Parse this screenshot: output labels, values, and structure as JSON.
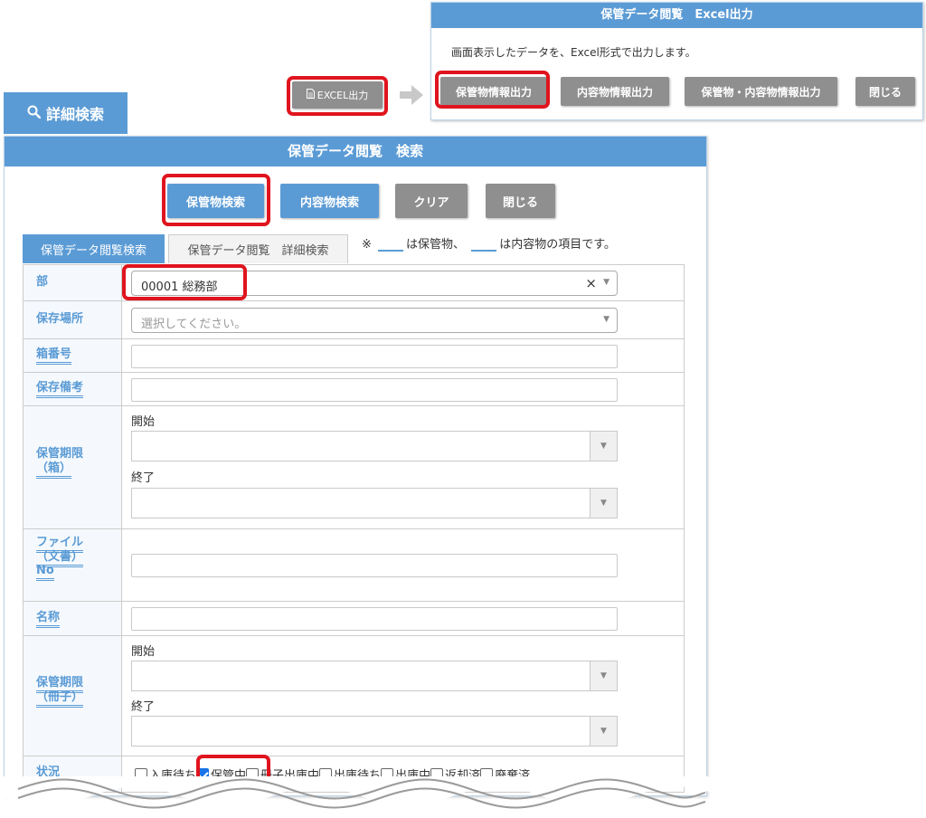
{
  "excel_dialog": {
    "title": "保管データ閲覧　Excel出力",
    "message": "画面表示したデータを、Excel形式で出力します。",
    "buttons": {
      "storage_info": "保管物情報出力",
      "content_info": "内容物情報出力",
      "both_info": "保管物・内容物情報出力",
      "close": "閉じる"
    }
  },
  "excel_button": {
    "label": "EXCEL出力",
    "icon": "document-icon"
  },
  "detail_search_tab": {
    "label": "詳細検索",
    "icon": "search-icon"
  },
  "search_panel": {
    "title": "保管データ閲覧　検索",
    "buttons": {
      "storage_search": "保管物検索",
      "content_search": "内容物検索",
      "clear": "クリア",
      "close": "閉じる"
    },
    "tabs": {
      "basic": "保管データ閲覧検索",
      "detail": "保管データ閲覧　詳細検索"
    },
    "note": {
      "prefix": "※",
      "storage_suffix": "は保管物、",
      "content_suffix": "は内容物の項目です。"
    },
    "fields": {
      "department": {
        "label": "部",
        "value": "00001 総務部",
        "clear_symbol": "×"
      },
      "location": {
        "label": "保存場所",
        "placeholder": "選択してください。"
      },
      "box_no": {
        "label": "箱番号",
        "value": ""
      },
      "storage_note": {
        "label": "保存備考",
        "value": ""
      },
      "retention_box": {
        "label_line1": "保管期限",
        "label_line2": "（箱）",
        "start_label": "開始",
        "end_label": "終了"
      },
      "file_no": {
        "label_line1": "ファイル",
        "label_line2": "（文書）",
        "label_line3": "No",
        "value": ""
      },
      "name": {
        "label": "名称",
        "value": ""
      },
      "retention_booklet": {
        "label_line1": "保管期限",
        "label_line2": "（冊子）",
        "start_label": "開始",
        "end_label": "終了"
      },
      "status": {
        "label": "状況",
        "options": [
          {
            "label": "入庫待ち",
            "checked": false
          },
          {
            "label": "保管中",
            "checked": true
          },
          {
            "label": "冊子出庫中",
            "checked": false
          },
          {
            "label": "出庫待ち",
            "checked": false
          },
          {
            "label": "出庫中",
            "checked": false
          },
          {
            "label": "返却済",
            "checked": false
          },
          {
            "label": "廃棄済",
            "checked": false
          }
        ]
      }
    }
  },
  "colors": {
    "accent_blue": "#5b9bd5",
    "button_gray": "#8f8f8f",
    "highlight_red": "#e0141e"
  }
}
